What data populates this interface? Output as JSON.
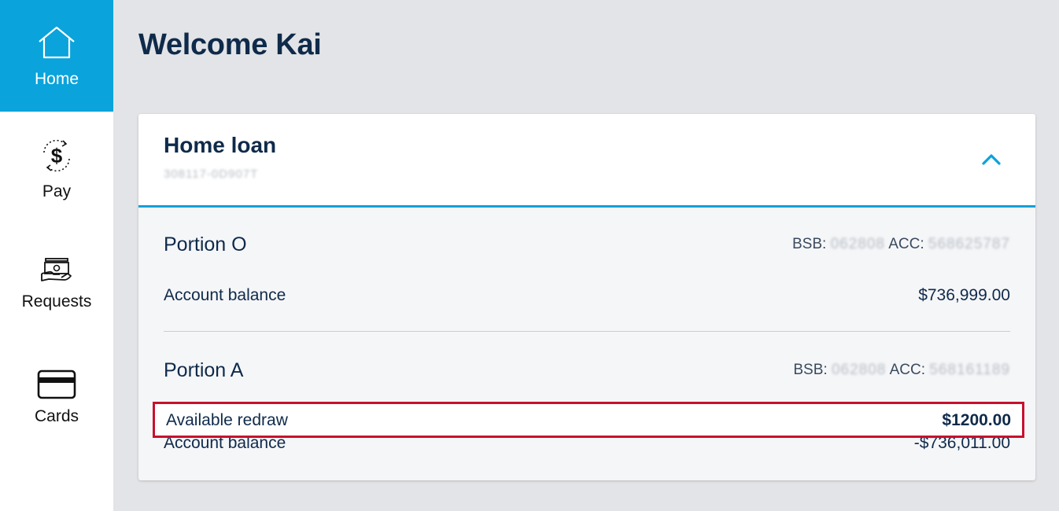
{
  "sidebar": {
    "items": [
      {
        "label": "Home",
        "icon": "house-icon",
        "active": true
      },
      {
        "label": "Pay",
        "icon": "dollar-cycle-icon"
      },
      {
        "label": "Requests",
        "icon": "cash-hand-icon"
      },
      {
        "label": "Cards",
        "icon": "credit-card-icon"
      }
    ]
  },
  "header": {
    "title": "Welcome Kai"
  },
  "loan_card": {
    "title": "Home loan",
    "account_number": "308117-0D907T",
    "portions": [
      {
        "name": "Portion O",
        "bsb_label": "BSB:",
        "bsb_value": "062808",
        "acc_label": "ACC:",
        "acc_value": "568625787",
        "account_balance_label": "Account balance",
        "account_balance_value": "$736,999.00"
      },
      {
        "name": "Portion A",
        "bsb_label": "BSB:",
        "bsb_value": "062808",
        "acc_label": "ACC:",
        "acc_value": "568161189",
        "available_redraw_label": "Available redraw",
        "available_redraw_value": "$1200.00",
        "account_balance_label": "Account balance",
        "account_balance_value": "-$736,011.00"
      }
    ]
  },
  "colors": {
    "accent": "#0aa3dc",
    "navy": "#0f2a4a",
    "highlight": "#c8102e",
    "background": "#e3e4e7"
  }
}
